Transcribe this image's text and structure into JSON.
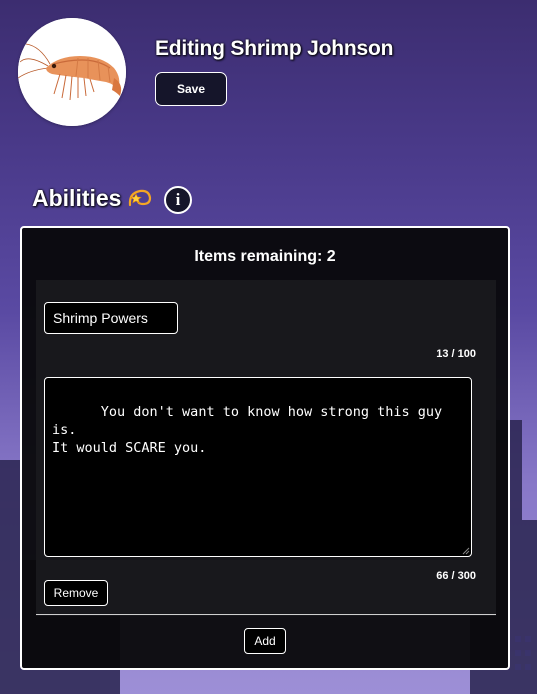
{
  "header": {
    "title": "Editing Shrimp Johnson",
    "save_label": "Save",
    "avatar_icon": "shrimp-image"
  },
  "abilities": {
    "title": "Abilities",
    "emoji_icon": "dizzy-star-emoji",
    "info_label": "i",
    "items_remaining": "Items remaining: 2",
    "items": [
      {
        "name": "Shrimp Powers",
        "name_counter": "13 / 100",
        "description": "You don't want to know how strong this guy is.\nIt would SCARE you.",
        "description_counter": "66 / 300",
        "remove_label": "Remove"
      }
    ],
    "add_label": "Add"
  },
  "colors": {
    "background_top": "#3c2d70",
    "background_bottom": "#9d8fd6",
    "panel": "#08080a",
    "button_dark": "#15152a",
    "text": "#ffffff"
  }
}
